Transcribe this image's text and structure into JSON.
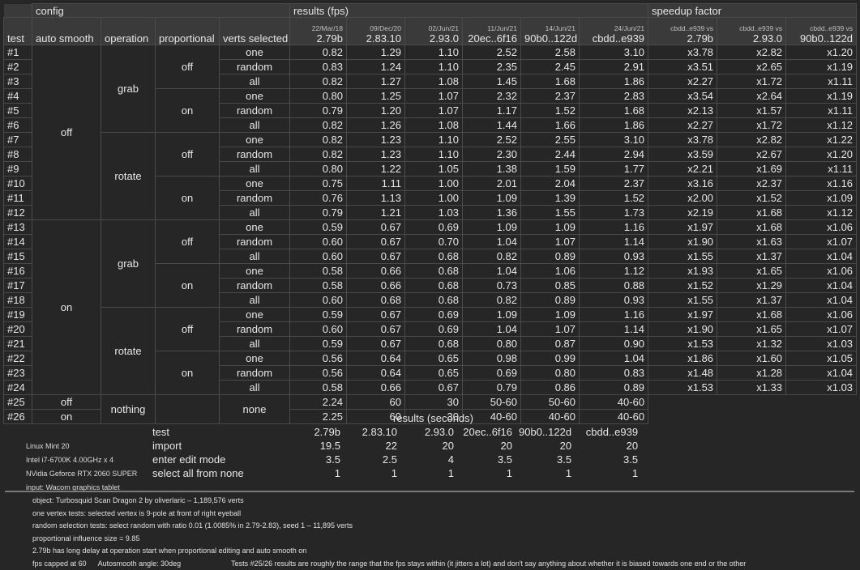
{
  "headers": {
    "config": "config",
    "results_fps": "results (fps)",
    "speedup": "speedup factor",
    "test": "test",
    "auto_smooth": "auto smooth",
    "operation": "operation",
    "proportional": "proportional",
    "verts_selected": "verts selected"
  },
  "versions": [
    {
      "date": "22/Mar/18",
      "label": "2.79b"
    },
    {
      "date": "09/Dec/20",
      "label": "2.83.10"
    },
    {
      "date": "02/Jun/21",
      "label": "2.93.0"
    },
    {
      "date": "11/Jun/21",
      "label": "20ec..6f16"
    },
    {
      "date": "14/Jun/21",
      "label": "90b0..122d"
    },
    {
      "date": "24/Jun/21",
      "label": "cbdd..e939"
    }
  ],
  "speedup_cols": [
    {
      "top": "cbdd..e939 vs",
      "label": "2.79b"
    },
    {
      "top": "cbdd..e939 vs",
      "label": "2.93.0"
    },
    {
      "top": "cbdd..e939 vs",
      "label": "90b0..122d"
    }
  ],
  "config_labels": {
    "off": "off",
    "on": "on",
    "grab": "grab",
    "rotate": "rotate",
    "nothing": "nothing",
    "one": "one",
    "random": "random",
    "all": "all",
    "none": "none"
  },
  "rows": [
    {
      "test": "#1",
      "fps": [
        "0.82",
        "1.29",
        "1.10",
        "2.52",
        "2.58",
        "3.10"
      ],
      "speedup": [
        "x3.78",
        "x2.82",
        "x1.20"
      ]
    },
    {
      "test": "#2",
      "fps": [
        "0.83",
        "1.24",
        "1.10",
        "2.35",
        "2.45",
        "2.91"
      ],
      "speedup": [
        "x3.51",
        "x2.65",
        "x1.19"
      ]
    },
    {
      "test": "#3",
      "fps": [
        "0.82",
        "1.27",
        "1.08",
        "1.45",
        "1.68",
        "1.86"
      ],
      "speedup": [
        "x2.27",
        "x1.72",
        "x1.11"
      ]
    },
    {
      "test": "#4",
      "fps": [
        "0.80",
        "1.25",
        "1.07",
        "2.32",
        "2.37",
        "2.83"
      ],
      "speedup": [
        "x3.54",
        "x2.64",
        "x1.19"
      ]
    },
    {
      "test": "#5",
      "fps": [
        "0.79",
        "1.20",
        "1.07",
        "1.17",
        "1.52",
        "1.68"
      ],
      "speedup": [
        "x2.13",
        "x1.57",
        "x1.11"
      ]
    },
    {
      "test": "#6",
      "fps": [
        "0.82",
        "1.26",
        "1.08",
        "1.44",
        "1.66",
        "1.86"
      ],
      "speedup": [
        "x2.27",
        "x1.72",
        "x1.12"
      ]
    },
    {
      "test": "#7",
      "fps": [
        "0.82",
        "1.23",
        "1.10",
        "2.52",
        "2.55",
        "3.10"
      ],
      "speedup": [
        "x3.78",
        "x2.82",
        "x1.22"
      ]
    },
    {
      "test": "#8",
      "fps": [
        "0.82",
        "1.23",
        "1.10",
        "2.30",
        "2.44",
        "2.94"
      ],
      "speedup": [
        "x3.59",
        "x2.67",
        "x1.20"
      ]
    },
    {
      "test": "#9",
      "fps": [
        "0.80",
        "1.22",
        "1.05",
        "1.38",
        "1.59",
        "1.77"
      ],
      "speedup": [
        "x2.21",
        "x1.69",
        "x1.11"
      ]
    },
    {
      "test": "#10",
      "fps": [
        "0.75",
        "1.11",
        "1.00",
        "2.01",
        "2.04",
        "2.37"
      ],
      "speedup": [
        "x3.16",
        "x2.37",
        "x1.16"
      ]
    },
    {
      "test": "#11",
      "fps": [
        "0.76",
        "1.13",
        "1.00",
        "1.09",
        "1.39",
        "1.52"
      ],
      "speedup": [
        "x2.00",
        "x1.52",
        "x1.09"
      ]
    },
    {
      "test": "#12",
      "fps": [
        "0.79",
        "1.21",
        "1.03",
        "1.36",
        "1.55",
        "1.73"
      ],
      "speedup": [
        "x2.19",
        "x1.68",
        "x1.12"
      ]
    },
    {
      "test": "#13",
      "fps": [
        "0.59",
        "0.67",
        "0.69",
        "1.09",
        "1.09",
        "1.16"
      ],
      "speedup": [
        "x1.97",
        "x1.68",
        "x1.06"
      ]
    },
    {
      "test": "#14",
      "fps": [
        "0.60",
        "0.67",
        "0.70",
        "1.04",
        "1.07",
        "1.14"
      ],
      "speedup": [
        "x1.90",
        "x1.63",
        "x1.07"
      ]
    },
    {
      "test": "#15",
      "fps": [
        "0.60",
        "0.67",
        "0.68",
        "0.82",
        "0.89",
        "0.93"
      ],
      "speedup": [
        "x1.55",
        "x1.37",
        "x1.04"
      ]
    },
    {
      "test": "#16",
      "fps": [
        "0.58",
        "0.66",
        "0.68",
        "1.04",
        "1.06",
        "1.12"
      ],
      "speedup": [
        "x1.93",
        "x1.65",
        "x1.06"
      ]
    },
    {
      "test": "#17",
      "fps": [
        "0.58",
        "0.66",
        "0.68",
        "0.73",
        "0.85",
        "0.88"
      ],
      "speedup": [
        "x1.52",
        "x1.29",
        "x1.04"
      ]
    },
    {
      "test": "#18",
      "fps": [
        "0.60",
        "0.68",
        "0.68",
        "0.82",
        "0.89",
        "0.93"
      ],
      "speedup": [
        "x1.55",
        "x1.37",
        "x1.04"
      ]
    },
    {
      "test": "#19",
      "fps": [
        "0.59",
        "0.67",
        "0.69",
        "1.09",
        "1.09",
        "1.16"
      ],
      "speedup": [
        "x1.97",
        "x1.68",
        "x1.06"
      ]
    },
    {
      "test": "#20",
      "fps": [
        "0.60",
        "0.67",
        "0.69",
        "1.04",
        "1.07",
        "1.14"
      ],
      "speedup": [
        "x1.90",
        "x1.65",
        "x1.07"
      ]
    },
    {
      "test": "#21",
      "fps": [
        "0.59",
        "0.67",
        "0.68",
        "0.80",
        "0.87",
        "0.90"
      ],
      "speedup": [
        "x1.53",
        "x1.32",
        "x1.03"
      ]
    },
    {
      "test": "#22",
      "fps": [
        "0.56",
        "0.64",
        "0.65",
        "0.98",
        "0.99",
        "1.04"
      ],
      "speedup": [
        "x1.86",
        "x1.60",
        "x1.05"
      ]
    },
    {
      "test": "#23",
      "fps": [
        "0.56",
        "0.64",
        "0.65",
        "0.69",
        "0.80",
        "0.83"
      ],
      "speedup": [
        "x1.48",
        "x1.28",
        "x1.04"
      ]
    },
    {
      "test": "#24",
      "fps": [
        "0.58",
        "0.66",
        "0.67",
        "0.79",
        "0.86",
        "0.89"
      ],
      "speedup": [
        "x1.53",
        "x1.33",
        "x1.03"
      ]
    },
    {
      "test": "#25",
      "fps": [
        "2.24",
        "60",
        "30",
        "50-60",
        "50-60",
        "40-60"
      ],
      "speedup": []
    },
    {
      "test": "#26",
      "fps": [
        "2.25",
        "60",
        "30",
        "40-60",
        "40-60",
        "40-60"
      ],
      "speedup": []
    }
  ],
  "seconds": {
    "title": "results (seconds)",
    "header": [
      "test",
      "2.79b",
      "2.83.10",
      "2.93.0",
      "20ec..6f16",
      "90b0..122d",
      "cbdd..e939"
    ],
    "rows": [
      {
        "sys": "Linux Mint 20",
        "label": "import",
        "values": [
          "19.5",
          "22",
          "20",
          "20",
          "20",
          "20"
        ]
      },
      {
        "sys": "Intel i7-6700K 4.00GHz x 4",
        "label": "enter edit mode",
        "values": [
          "3.5",
          "2.5",
          "4",
          "3.5",
          "3.5",
          "3.5"
        ]
      },
      {
        "sys": "NVidia Geforce RTX 2060 SUPER",
        "label": "select all from none",
        "values": [
          "1",
          "1",
          "1",
          "1",
          "1",
          "1"
        ]
      }
    ],
    "sys_first": "",
    "sys_last": "input: Wacom graphics tablet"
  },
  "notes": [
    "object: Turbosquid Scan Dragon 2 by oliverlaric – 1,189,576 verts",
    "one vertex tests: selected vertex is 9-pole at front of right eyeball",
    "random selection tests: select random with ratio 0.01 (1.0085% in 2.79-2.83), seed 1 – 11,895 verts",
    "proportional influence size = 9.85",
    "2.79b has long delay at operation start when proportional editing and auto smooth on"
  ],
  "notes_last": {
    "a": "fps capped at 60",
    "b": "Autosmooth angle: 30deg",
    "c": "Tests #25/26 results are roughly the range that the fps stays within (it jitters a lot) and don't say anything about whether it is biased towards one end or the other"
  }
}
